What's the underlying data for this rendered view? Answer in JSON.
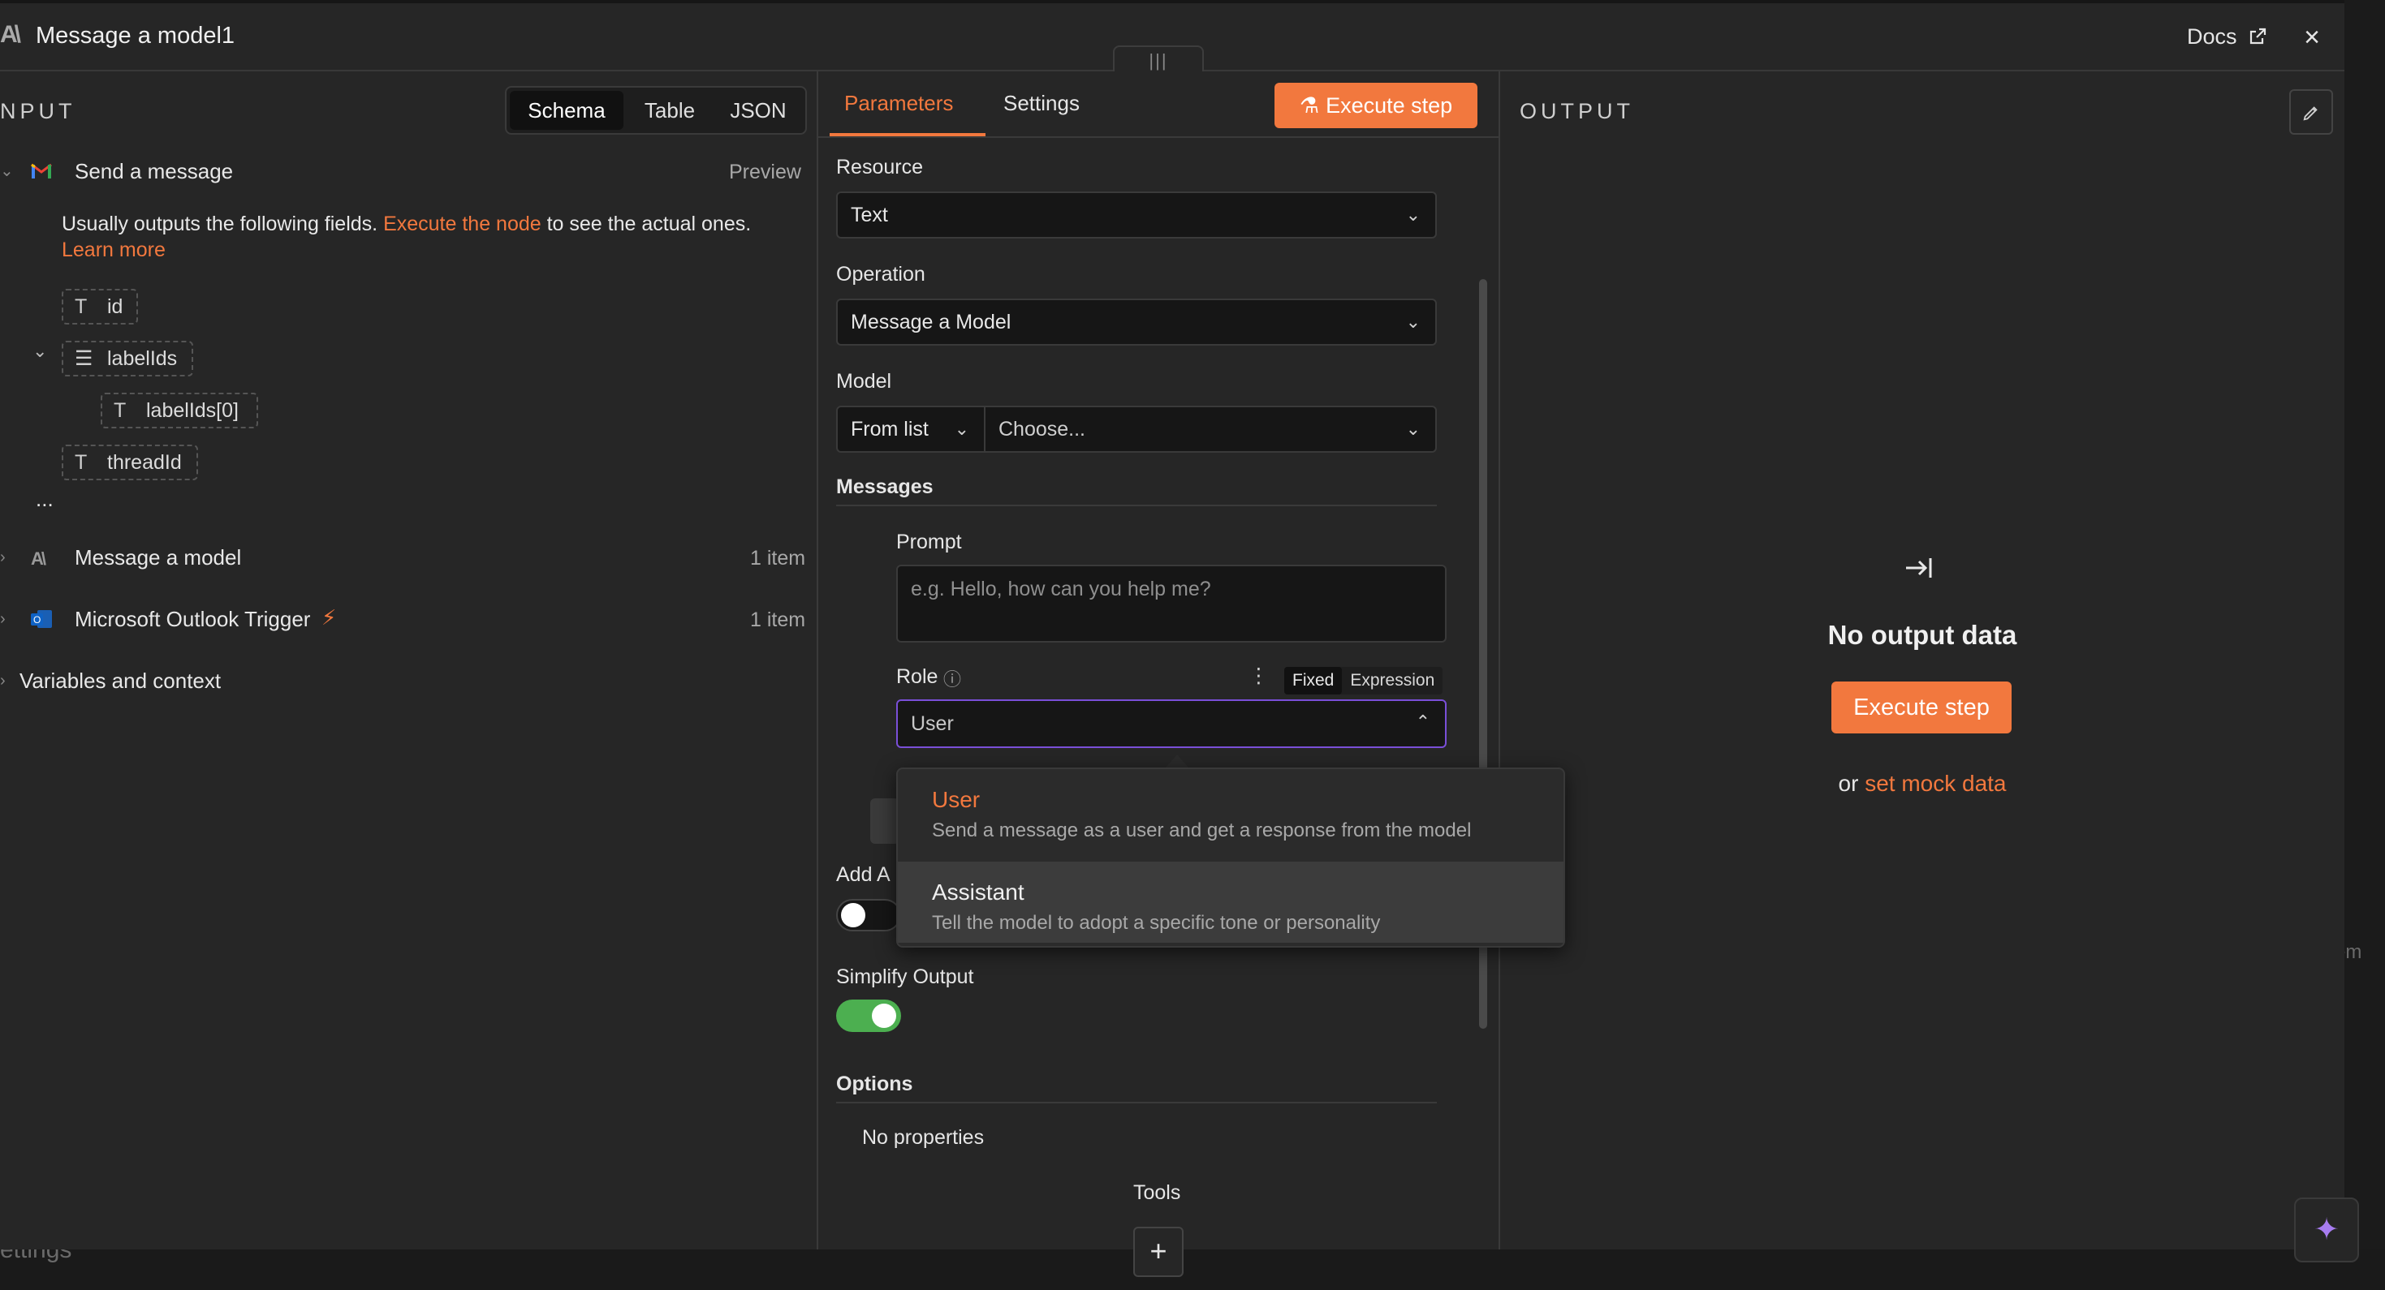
{
  "modal": {
    "title": "Message a model1",
    "docs_label": "Docs",
    "close_glyph": "×",
    "drag_glyph": "|||"
  },
  "input": {
    "heading": "NPUT",
    "view_tabs": [
      "Schema",
      "Table",
      "JSON"
    ],
    "node_send": {
      "name": "Send a message",
      "action": "Preview"
    },
    "hint_pre": "Usually outputs the following fields.",
    "hint_link": "Execute the node",
    "hint_post": "to see the actual ones.",
    "learn_more": "Learn more",
    "fields": {
      "id": "id",
      "labelIds": "labelIds",
      "labelIds0": "labelIds[0]",
      "threadId": "threadId",
      "ellipsis": "..."
    },
    "node_model": {
      "name": "Message a model",
      "count": "1 item"
    },
    "node_outlook": {
      "name": "Microsoft Outlook Trigger",
      "count": "1 item"
    },
    "vars": "Variables and context"
  },
  "params": {
    "tabs": {
      "parameters": "Parameters",
      "settings": "Settings"
    },
    "execute_label": "Execute step",
    "resource": {
      "label": "Resource",
      "value": "Text"
    },
    "operation": {
      "label": "Operation",
      "value": "Message a Model"
    },
    "model": {
      "label": "Model",
      "mode": "From list",
      "placeholder": "Choose..."
    },
    "messages_label": "Messages",
    "prompt": {
      "label": "Prompt",
      "placeholder": "e.g. Hello, how can you help me?"
    },
    "role": {
      "label": "Role",
      "fixed": "Fixed",
      "expression": "Expression",
      "value": "User"
    },
    "add_label": "Add A",
    "simplify": {
      "label": "Simplify Output",
      "on": true
    },
    "options": {
      "label": "Options",
      "empty": "No properties"
    },
    "tools_label": "Tools",
    "add_tool_glyph": "+"
  },
  "dropdown": [
    {
      "title": "User",
      "desc": "Send a message as a user and get a response from the model"
    },
    {
      "title": "Assistant",
      "desc": "Tell the model to adopt a specific tone or personality"
    }
  ],
  "output": {
    "heading": "OUTPUT",
    "empty_title": "No output data",
    "execute_label": "Execute step",
    "or": "or",
    "mock_link": "set mock data"
  },
  "background": {
    "settings_text": "ettings",
    "right_text": "em"
  },
  "colors": {
    "accent": "#f2783e",
    "toggle_on": "#4caf50",
    "focus": "#7a4fd8"
  }
}
